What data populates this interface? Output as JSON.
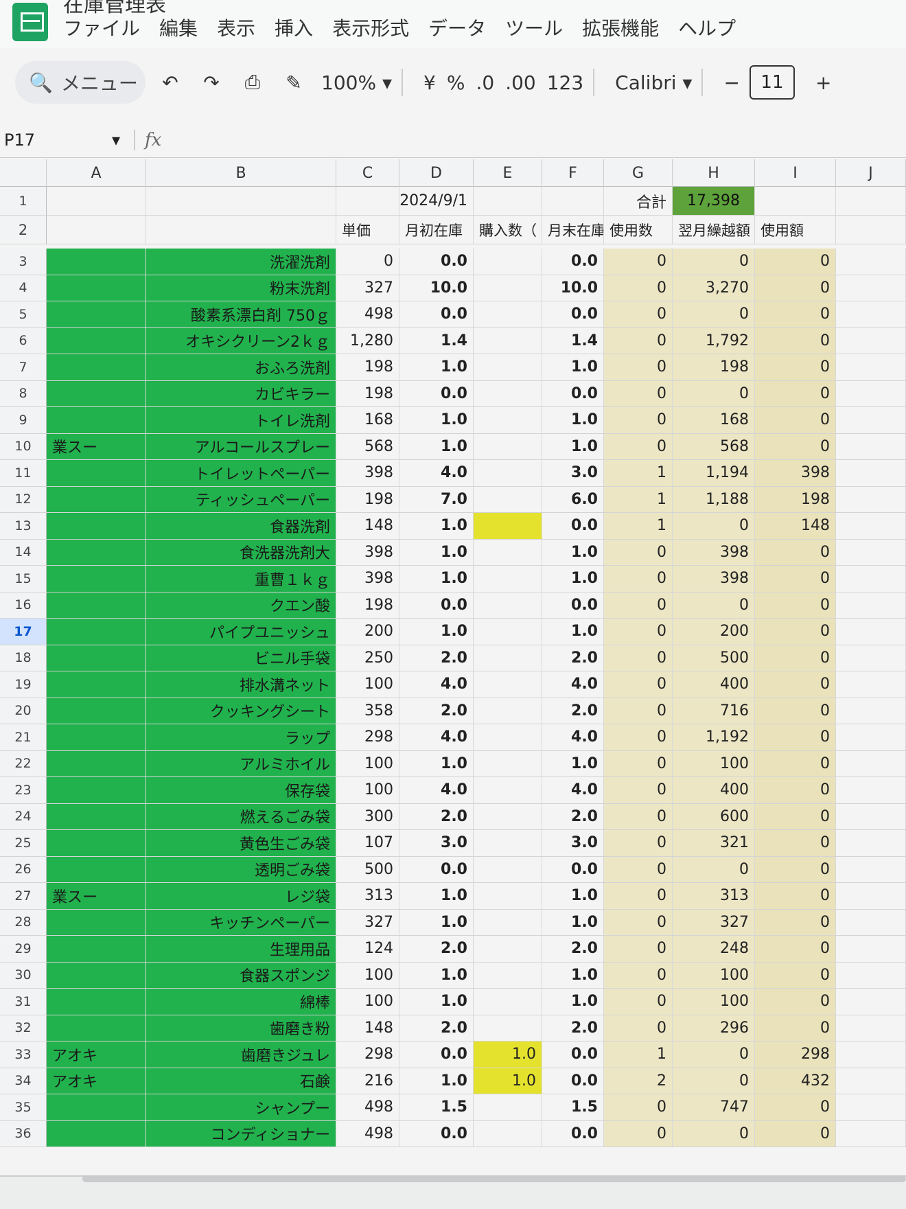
{
  "app": {
    "title": "在庫管理表",
    "menu": [
      "ファイル",
      "編集",
      "表示",
      "挿入",
      "表示形式",
      "データ",
      "ツール",
      "拡張機能",
      "ヘルプ"
    ]
  },
  "toolbar": {
    "search_label": "メニュー",
    "zoom": "100%",
    "currency": "¥",
    "percent": "%",
    "dec_decrease": ".0",
    "dec_increase": ".00",
    "number_format": "123",
    "font": "Calibri",
    "font_size": "11",
    "minus": "−",
    "plus": "+"
  },
  "formula_bar": {
    "cell_ref": "P17",
    "fx": "fx"
  },
  "columns": [
    "A",
    "B",
    "C",
    "D",
    "E",
    "F",
    "G",
    "H",
    "I",
    "J"
  ],
  "row1": {
    "date": "2024/9/1",
    "total_label": "合計",
    "total_value": "17,398"
  },
  "row2": {
    "c": "単価",
    "d": "月初在庫",
    "e": "購入数（",
    "f": "月末在庫",
    "g": "使用数",
    "h": "翌月繰越額",
    "i": "使用額"
  },
  "rows": [
    {
      "n": "3",
      "a": "",
      "b": "洗濯洗剤",
      "c": "0",
      "d": "0.0",
      "e": "",
      "f": "0.0",
      "g": "0",
      "h": "0",
      "i": "0"
    },
    {
      "n": "4",
      "a": "",
      "b": "粉末洗剤",
      "c": "327",
      "d": "10.0",
      "e": "",
      "f": "10.0",
      "g": "0",
      "h": "3,270",
      "i": "0"
    },
    {
      "n": "5",
      "a": "",
      "b": "酸素系漂白剤 750ｇ",
      "c": "498",
      "d": "0.0",
      "e": "",
      "f": "0.0",
      "g": "0",
      "h": "0",
      "i": "0"
    },
    {
      "n": "6",
      "a": "",
      "b": "オキシクリーン2ｋｇ",
      "c": "1,280",
      "d": "1.4",
      "e": "",
      "f": "1.4",
      "g": "0",
      "h": "1,792",
      "i": "0"
    },
    {
      "n": "7",
      "a": "",
      "b": "おふろ洗剤",
      "c": "198",
      "d": "1.0",
      "e": "",
      "f": "1.0",
      "g": "0",
      "h": "198",
      "i": "0"
    },
    {
      "n": "8",
      "a": "",
      "b": "カビキラー",
      "c": "198",
      "d": "0.0",
      "e": "",
      "f": "0.0",
      "g": "0",
      "h": "0",
      "i": "0"
    },
    {
      "n": "9",
      "a": "",
      "b": "トイレ洗剤",
      "c": "168",
      "d": "1.0",
      "e": "",
      "f": "1.0",
      "g": "0",
      "h": "168",
      "i": "0"
    },
    {
      "n": "10",
      "a": "業スー",
      "b": "アルコールスプレー",
      "c": "568",
      "d": "1.0",
      "e": "",
      "f": "1.0",
      "g": "0",
      "h": "568",
      "i": "0"
    },
    {
      "n": "11",
      "a": "",
      "b": "トイレットペーパー",
      "c": "398",
      "d": "4.0",
      "e": "",
      "f": "3.0",
      "g": "1",
      "h": "1,194",
      "i": "398"
    },
    {
      "n": "12",
      "a": "",
      "b": "ティッシュペーパー",
      "c": "198",
      "d": "7.0",
      "e": "",
      "f": "6.0",
      "g": "1",
      "h": "1,188",
      "i": "198"
    },
    {
      "n": "13",
      "a": "",
      "b": "食器洗剤",
      "c": "148",
      "d": "1.0",
      "e": "",
      "f": "0.0",
      "g": "1",
      "h": "0",
      "i": "148",
      "e_yellow": true
    },
    {
      "n": "14",
      "a": "",
      "b": "食洗器洗剤大",
      "c": "398",
      "d": "1.0",
      "e": "",
      "f": "1.0",
      "g": "0",
      "h": "398",
      "i": "0"
    },
    {
      "n": "15",
      "a": "",
      "b": "重曹１ｋｇ",
      "c": "398",
      "d": "1.0",
      "e": "",
      "f": "1.0",
      "g": "0",
      "h": "398",
      "i": "0"
    },
    {
      "n": "16",
      "a": "",
      "b": "クエン酸",
      "c": "198",
      "d": "0.0",
      "e": "",
      "f": "0.0",
      "g": "0",
      "h": "0",
      "i": "0"
    },
    {
      "n": "17",
      "a": "",
      "b": "パイプユニッシュ",
      "c": "200",
      "d": "1.0",
      "e": "",
      "f": "1.0",
      "g": "0",
      "h": "200",
      "i": "0"
    },
    {
      "n": "18",
      "a": "",
      "b": "ビニル手袋",
      "c": "250",
      "d": "2.0",
      "e": "",
      "f": "2.0",
      "g": "0",
      "h": "500",
      "i": "0"
    },
    {
      "n": "19",
      "a": "",
      "b": "排水溝ネット",
      "c": "100",
      "d": "4.0",
      "e": "",
      "f": "4.0",
      "g": "0",
      "h": "400",
      "i": "0"
    },
    {
      "n": "20",
      "a": "",
      "b": "クッキングシート",
      "c": "358",
      "d": "2.0",
      "e": "",
      "f": "2.0",
      "g": "0",
      "h": "716",
      "i": "0"
    },
    {
      "n": "21",
      "a": "",
      "b": "ラップ",
      "c": "298",
      "d": "4.0",
      "e": "",
      "f": "4.0",
      "g": "0",
      "h": "1,192",
      "i": "0"
    },
    {
      "n": "22",
      "a": "",
      "b": "アルミホイル",
      "c": "100",
      "d": "1.0",
      "e": "",
      "f": "1.0",
      "g": "0",
      "h": "100",
      "i": "0"
    },
    {
      "n": "23",
      "a": "",
      "b": "保存袋",
      "c": "100",
      "d": "4.0",
      "e": "",
      "f": "4.0",
      "g": "0",
      "h": "400",
      "i": "0"
    },
    {
      "n": "24",
      "a": "",
      "b": "燃えるごみ袋",
      "c": "300",
      "d": "2.0",
      "e": "",
      "f": "2.0",
      "g": "0",
      "h": "600",
      "i": "0"
    },
    {
      "n": "25",
      "a": "",
      "b": "黄色生ごみ袋",
      "c": "107",
      "d": "3.0",
      "e": "",
      "f": "3.0",
      "g": "0",
      "h": "321",
      "i": "0"
    },
    {
      "n": "26",
      "a": "",
      "b": "透明ごみ袋",
      "c": "500",
      "d": "0.0",
      "e": "",
      "f": "0.0",
      "g": "0",
      "h": "0",
      "i": "0"
    },
    {
      "n": "27",
      "a": "業スー",
      "b": "レジ袋",
      "c": "313",
      "d": "1.0",
      "e": "",
      "f": "1.0",
      "g": "0",
      "h": "313",
      "i": "0"
    },
    {
      "n": "28",
      "a": "",
      "b": "キッチンペーパー",
      "c": "327",
      "d": "1.0",
      "e": "",
      "f": "1.0",
      "g": "0",
      "h": "327",
      "i": "0"
    },
    {
      "n": "29",
      "a": "",
      "b": "生理用品",
      "c": "124",
      "d": "2.0",
      "e": "",
      "f": "2.0",
      "g": "0",
      "h": "248",
      "i": "0"
    },
    {
      "n": "30",
      "a": "",
      "b": "食器スポンジ",
      "c": "100",
      "d": "1.0",
      "e": "",
      "f": "1.0",
      "g": "0",
      "h": "100",
      "i": "0"
    },
    {
      "n": "31",
      "a": "",
      "b": "綿棒",
      "c": "100",
      "d": "1.0",
      "e": "",
      "f": "1.0",
      "g": "0",
      "h": "100",
      "i": "0"
    },
    {
      "n": "32",
      "a": "",
      "b": "歯磨き粉",
      "c": "148",
      "d": "2.0",
      "e": "",
      "f": "2.0",
      "g": "0",
      "h": "296",
      "i": "0"
    },
    {
      "n": "33",
      "a": "アオキ",
      "b": "歯磨きジュレ",
      "c": "298",
      "d": "0.0",
      "e": "1.0",
      "f": "0.0",
      "g": "1",
      "h": "0",
      "i": "298",
      "e_yellow": true
    },
    {
      "n": "34",
      "a": "アオキ",
      "b": "石鹸",
      "c": "216",
      "d": "1.0",
      "e": "1.0",
      "f": "0.0",
      "g": "2",
      "h": "0",
      "i": "432",
      "e_yellow": true
    },
    {
      "n": "35",
      "a": "",
      "b": "シャンプー",
      "c": "498",
      "d": "1.5",
      "e": "",
      "f": "1.5",
      "g": "0",
      "h": "747",
      "i": "0"
    },
    {
      "n": "36",
      "a": "",
      "b": "コンディショナー",
      "c": "498",
      "d": "0.0",
      "e": "",
      "f": "0.0",
      "g": "0",
      "h": "0",
      "i": "0"
    }
  ],
  "selected_row": "17",
  "colors": {
    "green": "#21b24d",
    "tan": "#ece6c5",
    "yellow": "#e5e22e",
    "total": "#5da23a",
    "selection": "#d3e3fd"
  }
}
